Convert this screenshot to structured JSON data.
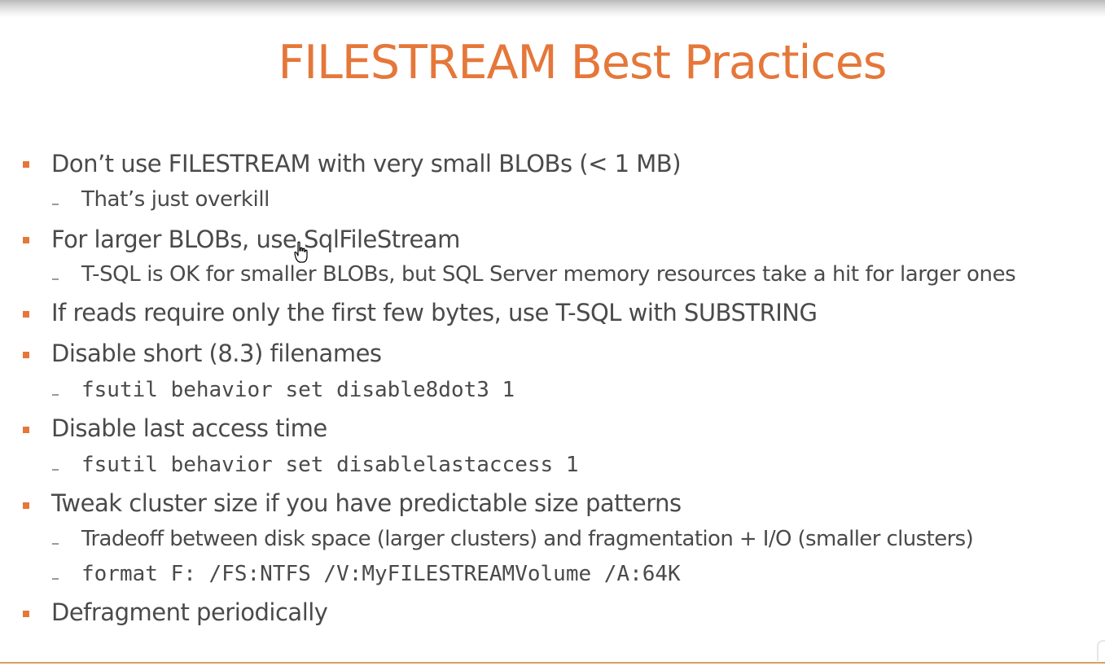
{
  "slide": {
    "title": "FILESTREAM Best Practices",
    "accent_color": "#e5773a",
    "text_color": "#4a4a4a",
    "items": [
      {
        "text": "Don’t use FILESTREAM with very small BLOBs (< 1 MB)",
        "subitems": [
          "That’s just overkill"
        ]
      },
      {
        "text": "For larger BLOBs, use SqlFileStream",
        "subitems": [
          "T-SQL is OK for smaller BLOBs, but SQL Server memory resources take a hit for larger ones"
        ]
      },
      {
        "text": "If reads require only the first few bytes, use T-SQL with SUBSTRING",
        "subitems": []
      },
      {
        "text": "Disable short (8.3) filenames",
        "subitems": [
          "fsutil behavior set disable8dot3 1"
        ]
      },
      {
        "text": "Disable last access time",
        "subitems": [
          "fsutil behavior set disablelastaccess 1"
        ]
      },
      {
        "text": "Tweak cluster size if you have predictable size patterns",
        "subitems": [
          "Tradeoff between disk space (larger clusters) and fragmentation + I/O (smaller clusters)",
          "format F: /FS:NTFS /V:MyFILESTREAMVolume /A:64K"
        ]
      },
      {
        "text": "Defragment periodically",
        "subitems": []
      }
    ]
  },
  "cursor": {
    "icon": "hand-pointer-icon"
  }
}
